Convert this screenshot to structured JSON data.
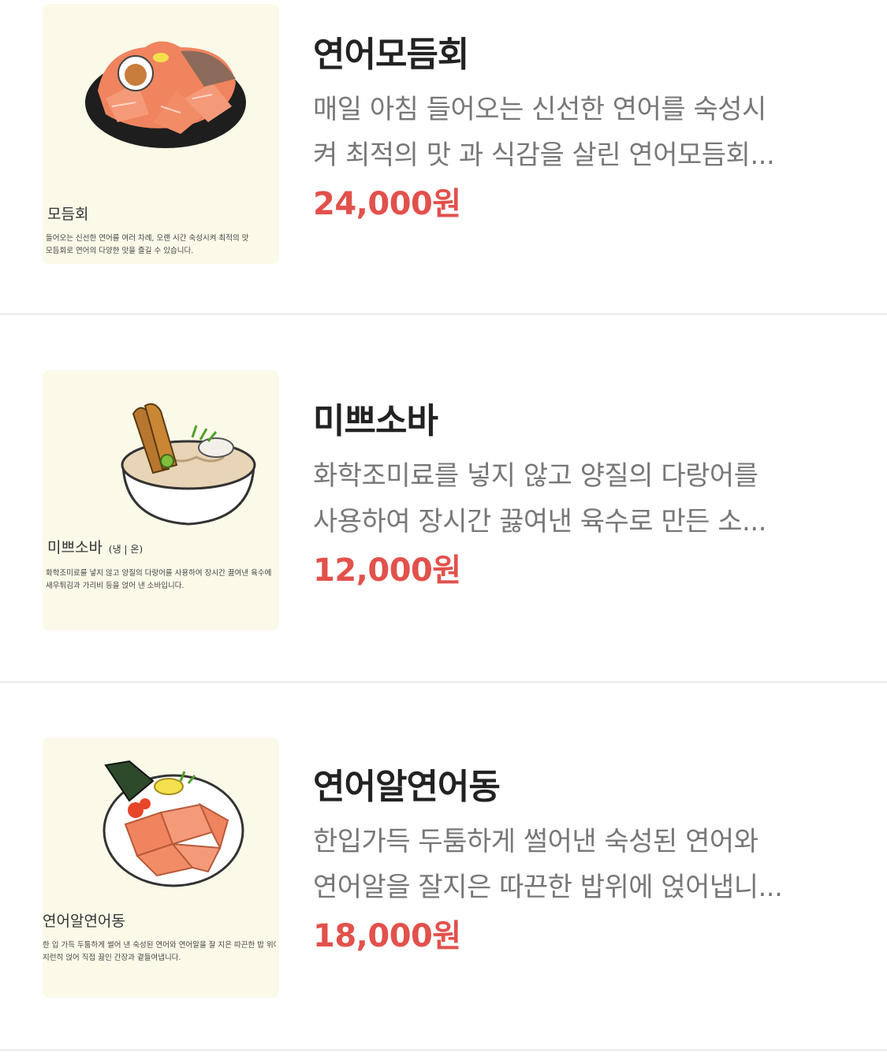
{
  "menu": {
    "items": [
      {
        "title": "연어모듬회",
        "description_line1": "매일 아침 들어오는 신선한 연어를 숙성시",
        "description_line2": "켜 최적의 맛 과 식감을 살린 연어모듬회...",
        "price": "24,000원",
        "image": {
          "caption": "모듬회",
          "caption_sub": "",
          "desc_line1": "들어오는 신선한 연어를 여러 차례, 오랜 시간 숙성시켜 최적의 맛",
          "desc_line2": "모듬회로 연어의 다양한 맛을 즐길 수 있습니다."
        }
      },
      {
        "title": "미쁘소바",
        "description_line1": "화학조미료를 넣지 않고 양질의 다랑어를",
        "description_line2": "사용하여 장시간 끓여낸 육수로 만든 소...",
        "price": "12,000원",
        "image": {
          "caption": "미쁘소바",
          "caption_sub": "(냉 | 온)",
          "desc_line1": "화학조미료를 넣지 않고 양질의 다랑어를 사용하여 장시간 끓여낸 육수에",
          "desc_line2": "새우튀김과 가리비 등을 얹어 낸 소바입니다."
        }
      },
      {
        "title": "연어알연어동",
        "description_line1": "한입가득 두툼하게 썰어낸 숙성된 연어와",
        "description_line2": "연어알을 잘지은 따끈한 밥위에 얹어냅니...",
        "price": "18,000원",
        "image": {
          "caption": "연어알연어동",
          "caption_sub": "",
          "desc_line1": "한 입 가득 두툼하게 썰어 낸 숙성된 연어와 연어알을 잘 지은 따끈한 밥 위에",
          "desc_line2": "지런히 얹어 직접 끓인 간장과 곁들여냅니다."
        }
      }
    ]
  },
  "colors": {
    "price": "#e2514c",
    "title": "#222222",
    "description": "#777777",
    "thumb_bg": "#fbf9e8"
  }
}
